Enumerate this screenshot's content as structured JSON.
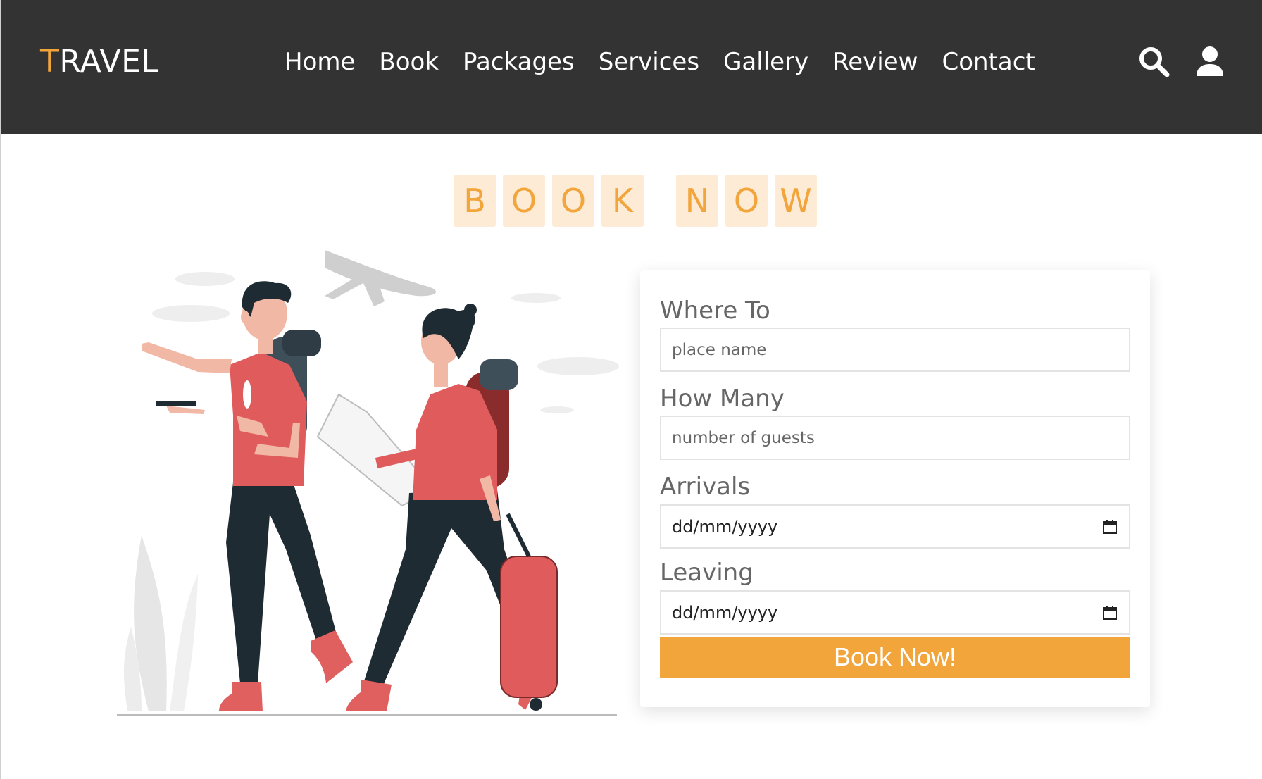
{
  "brand": {
    "first_letter": "T",
    "rest": "RAVEL"
  },
  "nav": {
    "items": [
      {
        "label": "Home"
      },
      {
        "label": "Book"
      },
      {
        "label": "Packages"
      },
      {
        "label": "Services"
      },
      {
        "label": "Gallery"
      },
      {
        "label": "Review"
      },
      {
        "label": "Contact"
      }
    ]
  },
  "icons": {
    "search": "search-icon",
    "user": "user-icon"
  },
  "heading": {
    "letters": [
      "B",
      "O",
      "O",
      "K",
      " ",
      "N",
      "O",
      "W"
    ]
  },
  "form": {
    "where_label": "Where To",
    "where_placeholder": "place name",
    "howmany_label": "How Many",
    "howmany_placeholder": "number of guests",
    "arrivals_label": "Arrivals",
    "arrivals_value": "dd/mm/yyyy",
    "leaving_label": "Leaving",
    "leaving_value": "dd/mm/yyyy",
    "submit_label": "Book Now!"
  },
  "colors": {
    "header_bg": "#333333",
    "accent": "#f2a53a",
    "letter_bg": "#fdebd6",
    "text_gray": "#666666"
  }
}
